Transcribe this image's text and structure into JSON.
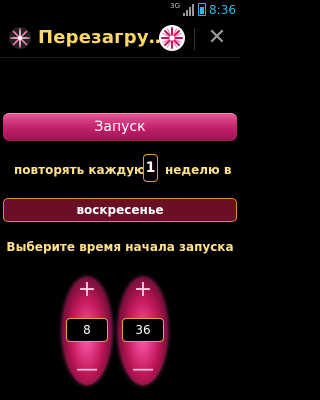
{
  "status_bar": {
    "network_type": "3G",
    "time": "8:36",
    "battery_color": "#33b5e5"
  },
  "action_bar": {
    "title": "Перезагру…",
    "app_icon": "starburst-icon",
    "action_icon": "starburst-icon",
    "close_icon": "close-icon"
  },
  "main": {
    "start_button_label": "Запуск",
    "repeat_prefix": "повторять каждую",
    "repeat_count": "1",
    "repeat_suffix": "неделю в",
    "day_of_week": "воскресенье",
    "choose_time_label": "Выберите время начала запуска"
  },
  "time_picker": {
    "hours": {
      "plus_label": "+",
      "value": "8",
      "minus_label": "—"
    },
    "minutes": {
      "plus_label": "+",
      "value": "36",
      "minus_label": "—"
    }
  },
  "colors": {
    "accent_pink": "#c0206a",
    "label_yellow": "#ffe08a",
    "title_yellow": "#ffd966"
  }
}
